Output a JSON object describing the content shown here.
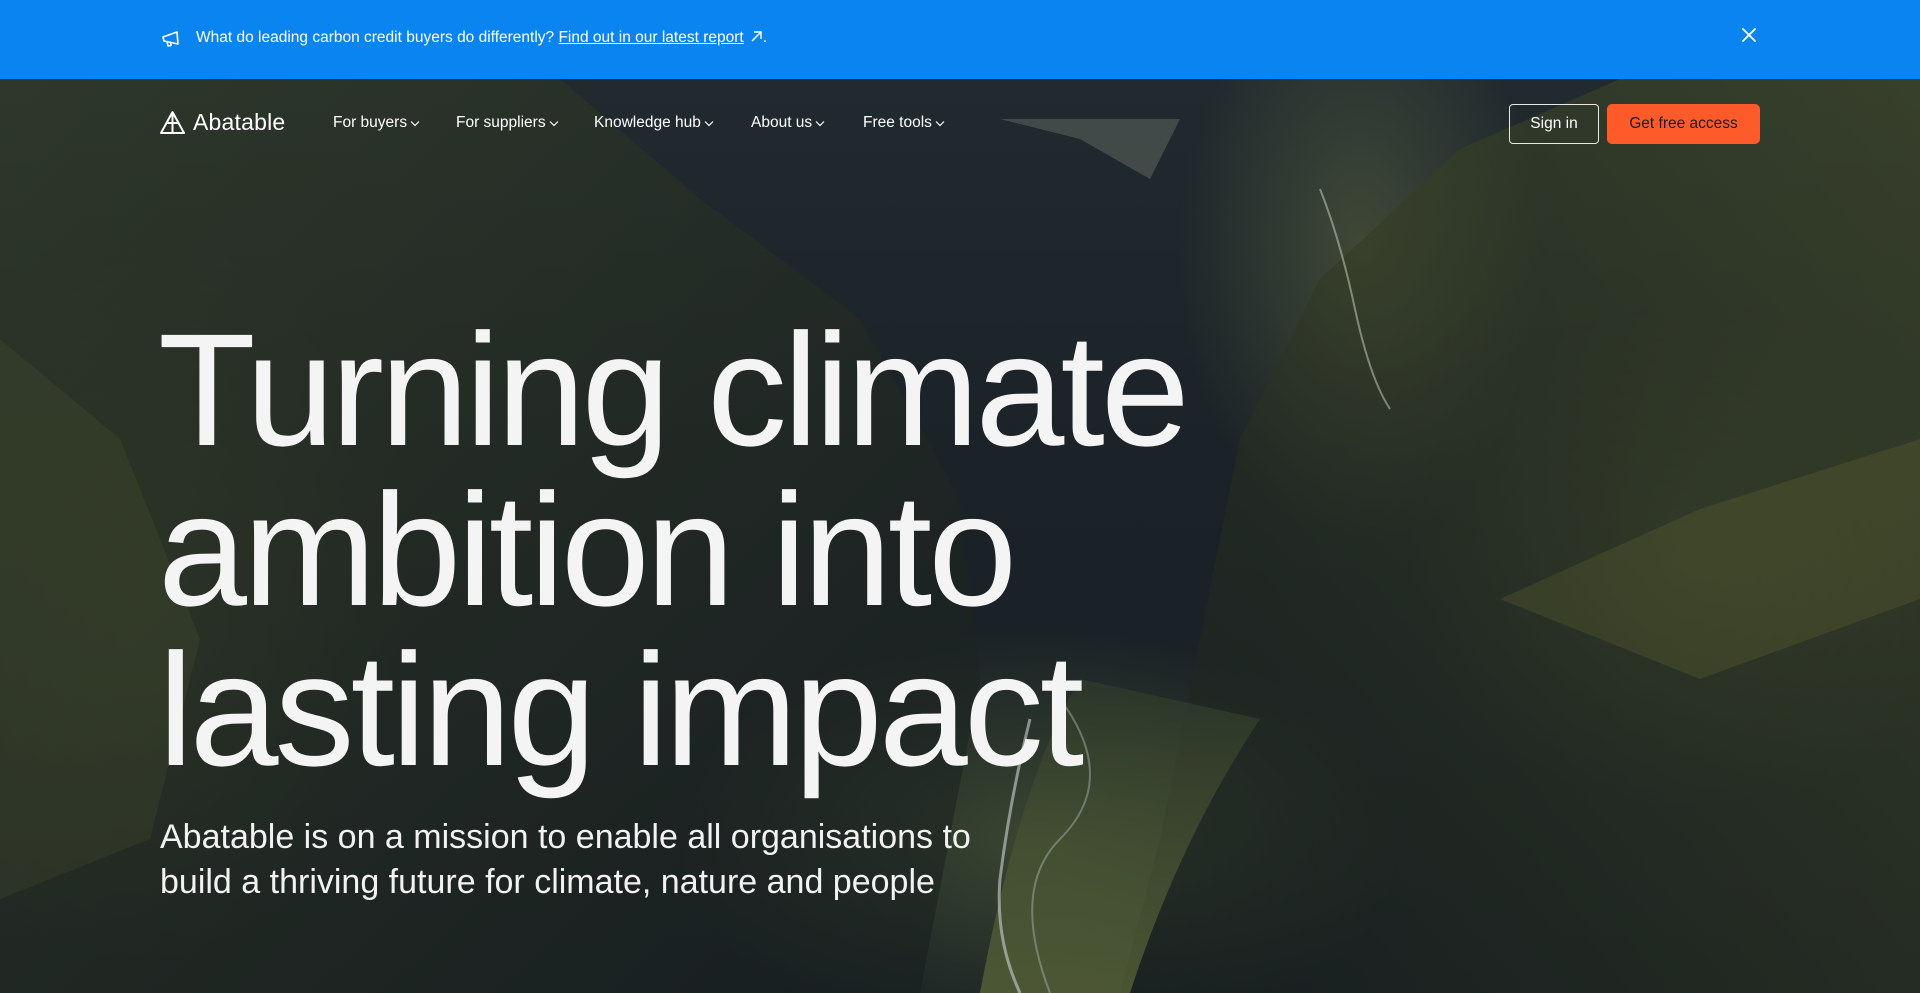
{
  "banner": {
    "text": "What do leading carbon credit buyers do differently?",
    "link_text": "Find out in our latest report",
    "trailing": ".",
    "background": "#0a84f0",
    "icons": {
      "left": "megaphone-icon",
      "link": "arrow-up-right-icon",
      "close": "close-icon"
    }
  },
  "nav": {
    "brand": "Abatable",
    "items": [
      {
        "label": "For buyers"
      },
      {
        "label": "For suppliers"
      },
      {
        "label": "Knowledge hub"
      },
      {
        "label": "About us"
      },
      {
        "label": "Free tools"
      }
    ],
    "sign_in": "Sign in",
    "cta": "Get free access",
    "cta_color": "#ff5a2a"
  },
  "hero": {
    "headline_lines": [
      "Turning climate",
      "ambition into",
      "lasting impact"
    ],
    "subhead_lines": [
      "Abatable is on a mission to enable all organisations to",
      "build a thriving future for climate, nature and people"
    ]
  }
}
